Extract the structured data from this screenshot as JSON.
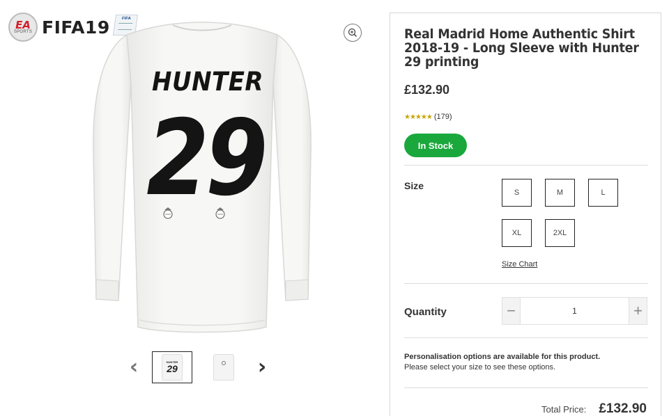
{
  "brand": {
    "ea_text": "EA",
    "sports_text": "SPORTS",
    "fifa_word": "FIFA19",
    "fifa_badge": "FIFA"
  },
  "product": {
    "jersey_name": "HUNTER",
    "jersey_number": "29",
    "title": "Real Madrid Home Authentic Shirt 2018-19 - Long Sleeve with Hunter 29 printing",
    "price": "£132.90",
    "stars": "★★★★★",
    "rating_count": "(179)",
    "stock_label": "In Stock"
  },
  "thumbnails": {
    "prev_arrow": "‹",
    "next_arrow": "›",
    "items": [
      {
        "name": "HUNTER",
        "number": "29"
      }
    ]
  },
  "size": {
    "label": "Size",
    "options": [
      "S",
      "M",
      "L",
      "XL",
      "2XL"
    ],
    "chart_link": "Size Chart"
  },
  "quantity": {
    "label": "Quantity",
    "value": "1",
    "minus": "−",
    "plus": "+"
  },
  "personalisation": {
    "line1": "Personalisation options are available for this product.",
    "line2": "Please select your size to see these options."
  },
  "total": {
    "label": "Total Price:",
    "value": "£132.90"
  },
  "colors": {
    "stock_green": "#1aa83c",
    "star_gold": "#c8a600"
  }
}
